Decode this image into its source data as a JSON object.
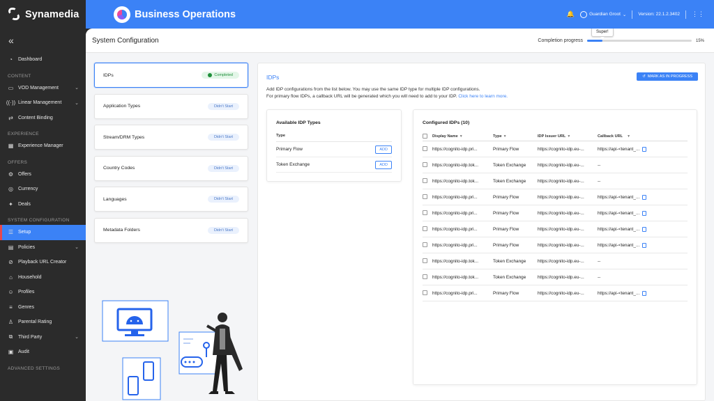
{
  "brand": {
    "name": "Synamedia"
  },
  "sidebar": {
    "collapse_icon": "double-chevron-left-icon",
    "groups": [
      {
        "section": "",
        "items": [
          {
            "label": "Dashboard",
            "icon": "dashboard-icon"
          }
        ]
      },
      {
        "section": "CONTENT",
        "items": [
          {
            "label": "VOD Management",
            "icon": "video-icon",
            "chevron": "⌄"
          },
          {
            "label": "Linear Management",
            "icon": "broadcast-icon",
            "chevron": "⌄"
          },
          {
            "label": "Content Binding",
            "icon": "link-icon"
          }
        ]
      },
      {
        "section": "EXPERIENCE",
        "items": [
          {
            "label": "Experience Manager",
            "icon": "layout-icon"
          }
        ]
      },
      {
        "section": "OFFERS",
        "items": [
          {
            "label": "Offers",
            "icon": "tag-icon"
          },
          {
            "label": "Currency",
            "icon": "currency-icon"
          },
          {
            "label": "Deals",
            "icon": "deal-icon"
          }
        ]
      },
      {
        "section": "SYSTEM CONFIGURATION",
        "items": [
          {
            "label": "Setup",
            "icon": "settings-icon",
            "active": true
          },
          {
            "label": "Policies",
            "icon": "policy-icon",
            "chevron": "⌄"
          },
          {
            "label": "Playback URL Creator",
            "icon": "play-link-icon"
          },
          {
            "label": "Household",
            "icon": "home-icon"
          },
          {
            "label": "Profiles",
            "icon": "profiles-icon"
          },
          {
            "label": "Genres",
            "icon": "genres-icon"
          },
          {
            "label": "Parental Rating",
            "icon": "parental-icon"
          },
          {
            "label": "Third Party",
            "icon": "third-party-icon",
            "chevron": "⌄"
          },
          {
            "label": "Audit",
            "icon": "audit-icon"
          }
        ]
      },
      {
        "section": "ADVANCED SETTINGS",
        "items": []
      }
    ]
  },
  "topbar": {
    "title": "Business Operations",
    "user": "Guardian Groot",
    "version": "Version: 22.1.2.3402"
  },
  "page": {
    "title": "System Configuration",
    "progress_label": "Completion progress",
    "progress_percent": 15,
    "progress_text": "15%",
    "tooltip": "Super!"
  },
  "steps": [
    {
      "label": "IDPs",
      "status": "Completed",
      "done": true
    },
    {
      "label": "Application Types",
      "status": "Didn't Start",
      "done": false
    },
    {
      "label": "Stream/DRM Types",
      "status": "Didn't Start",
      "done": false
    },
    {
      "label": "Country Codes",
      "status": "Didn't Start",
      "done": false
    },
    {
      "label": "Languages",
      "status": "Didn't Start",
      "done": false
    },
    {
      "label": "Metadata Folders",
      "status": "Didn't Start",
      "done": false
    }
  ],
  "idp": {
    "title": "IDPs",
    "mark_button": "MARK AS IN PROGRESS",
    "desc1": "Add IDP configurations from the list below. You may use the same IDP type for multiple IDP configurations.",
    "desc2": "For primary flow IDPs, a callback URL will be generated which you will need to add to your IDP.",
    "link": "Click here to learn more.",
    "available": {
      "title": "Available IDP Types",
      "header": "Type",
      "rows": [
        {
          "type": "Primary Flow",
          "button": "ADD"
        },
        {
          "type": "Token Exchange",
          "button": "ADD"
        }
      ]
    },
    "configured": {
      "title": "Configured IDPs (10)",
      "headers": [
        "Display Name",
        "Type",
        "IDP Issuer URL",
        "Callback URL"
      ],
      "rows": [
        [
          "https://cognito-idp.pri...",
          "Primary Flow",
          "https://cognito-idp.eu-...",
          "https://api-<tenant_..."
        ],
        [
          "https://cognito-idp.tok...",
          "Token Exchange",
          "https://cognito-idp.eu-...",
          "--"
        ],
        [
          "https://cognito-idp.tok...",
          "Token Exchange",
          "https://cognito-idp.eu-...",
          "--"
        ],
        [
          "https://cognito-idp.pri...",
          "Primary Flow",
          "https://cognito-idp.eu-...",
          "https://api-<tenant_..."
        ],
        [
          "https://cognito-idp.pri...",
          "Primary Flow",
          "https://cognito-idp.eu-...",
          "https://api-<tenant_..."
        ],
        [
          "https://cognito-idp.pri...",
          "Primary Flow",
          "https://cognito-idp.eu-...",
          "https://api-<tenant_..."
        ],
        [
          "https://cognito-idp.pri...",
          "Primary Flow",
          "https://cognito-idp.eu-...",
          "https://api-<tenant_..."
        ],
        [
          "https://cognito-idp.tok...",
          "Token Exchange",
          "https://cognito-idp.eu-...",
          "--"
        ],
        [
          "https://cognito-idp.tok...",
          "Token Exchange",
          "https://cognito-idp.eu-...",
          "--"
        ],
        [
          "https://cognito-idp.pri...",
          "Primary Flow",
          "https://cognito-idp.eu-...",
          "https://api-<tenant_..."
        ]
      ]
    }
  },
  "colors": {
    "accent": "#3b82f6",
    "sidebar": "#2b2b2b",
    "success": "#1f8f3a"
  }
}
